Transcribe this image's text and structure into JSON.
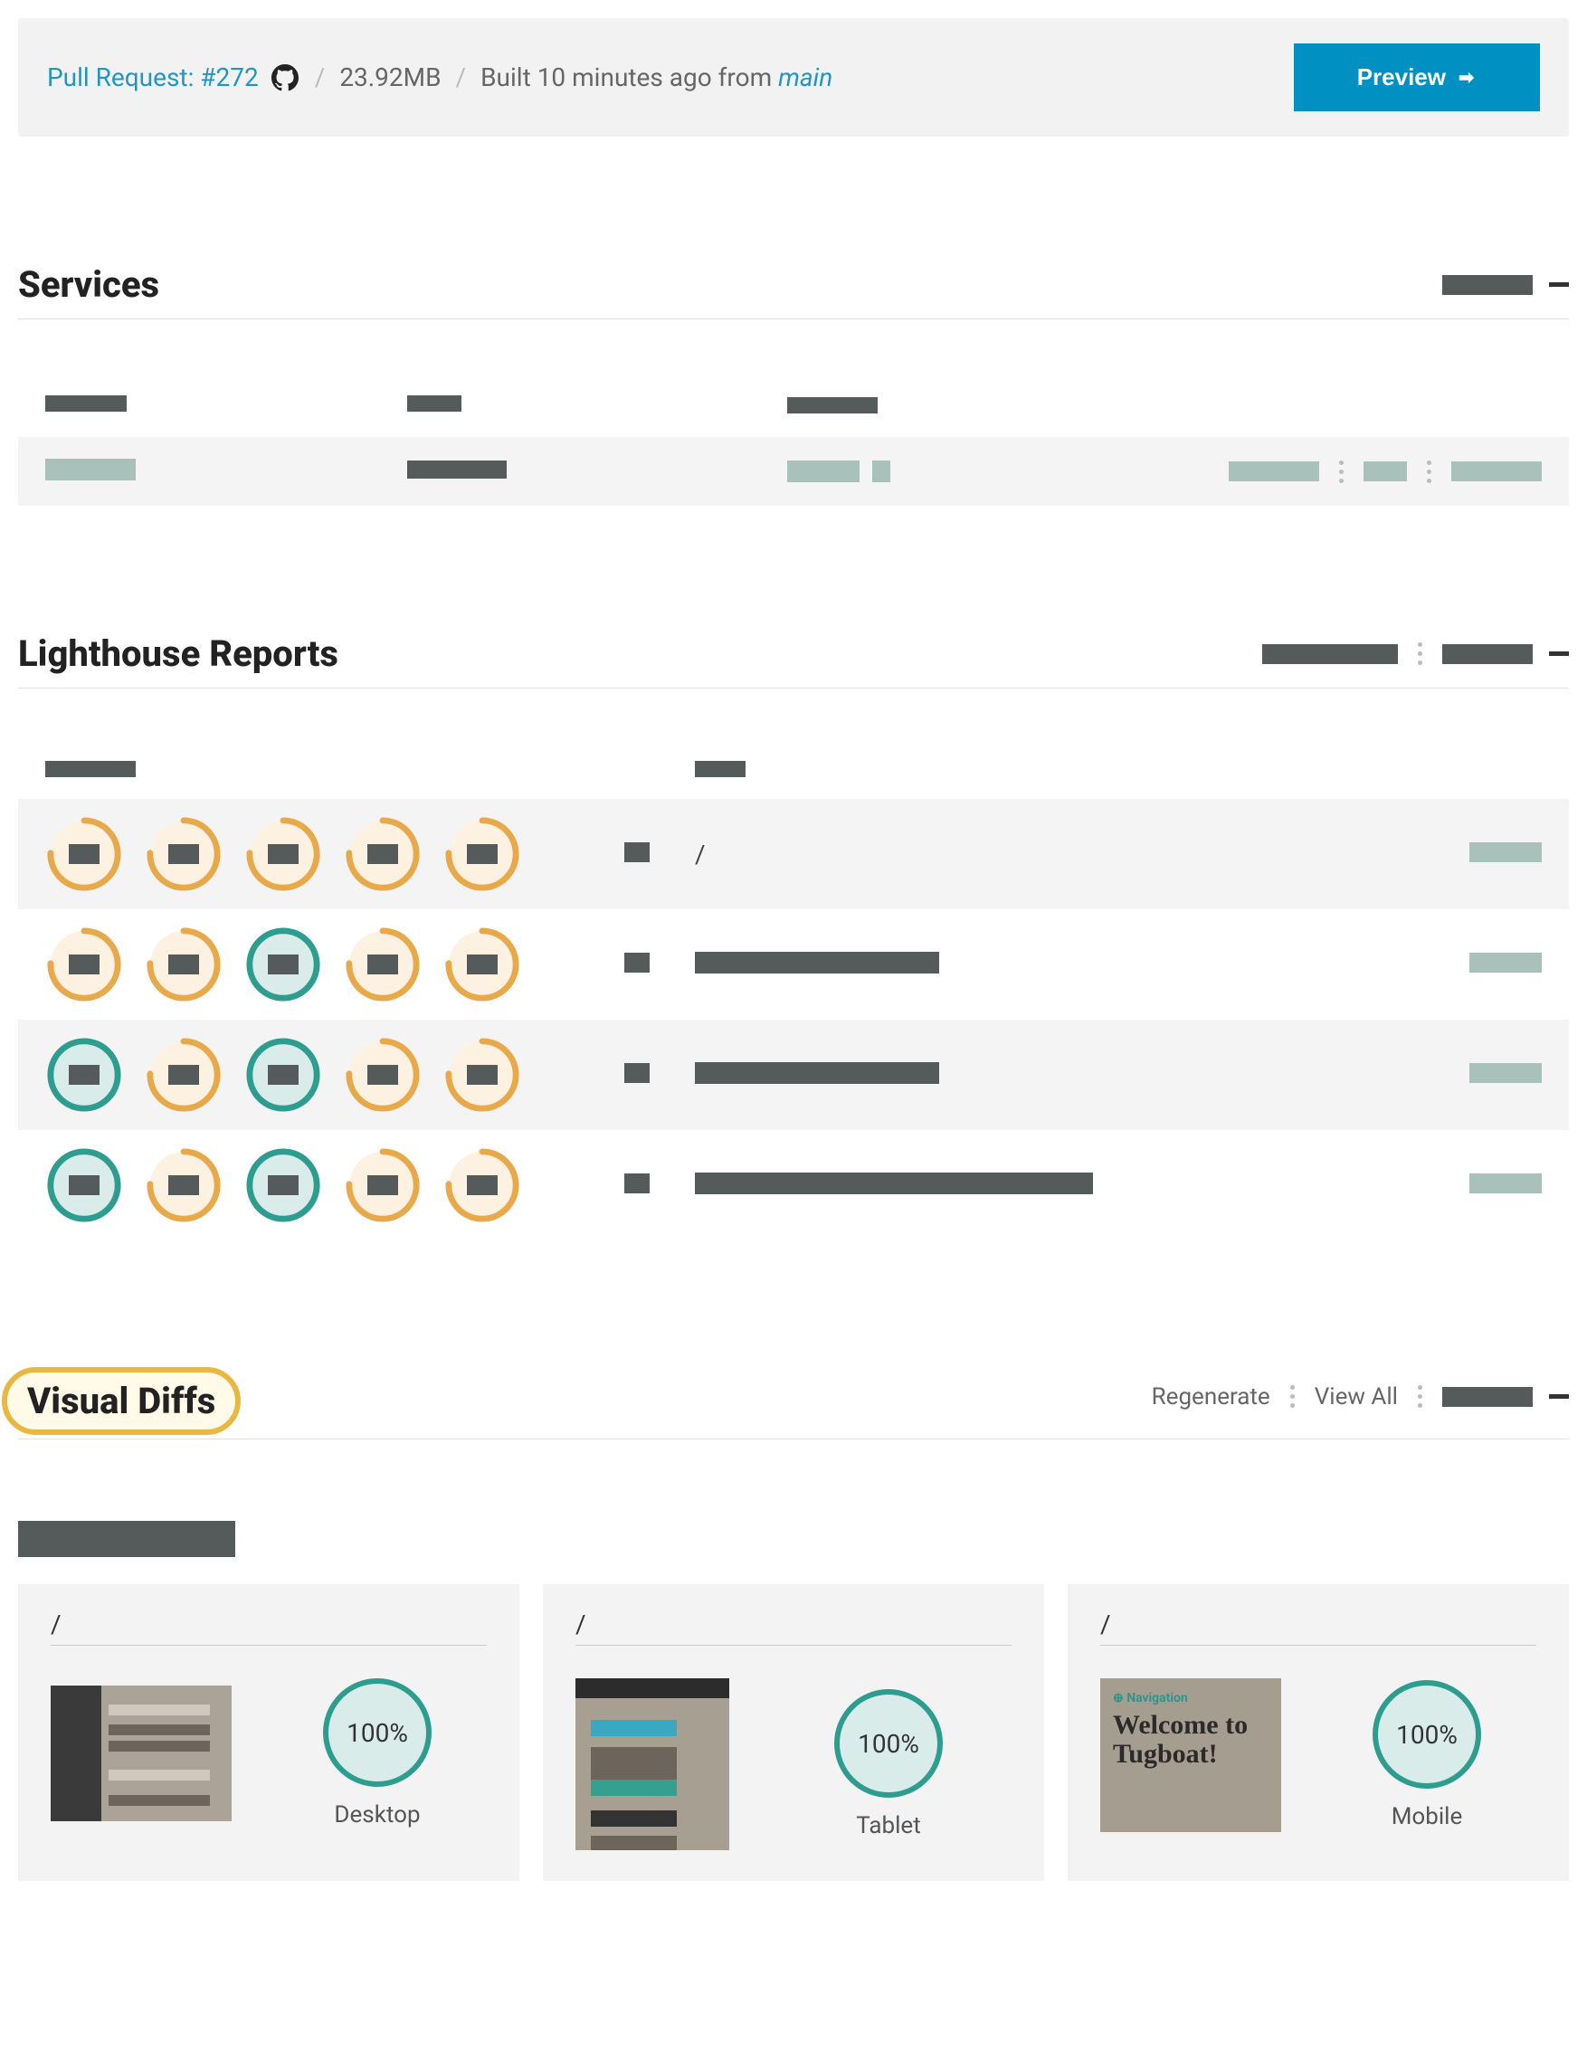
{
  "header": {
    "pr_label": "Pull Request: #272",
    "size": "23.92MB",
    "built_prefix": "Built 10 minutes ago from",
    "branch": "main",
    "preview_label": "Preview"
  },
  "services": {
    "title": "Services"
  },
  "lighthouse": {
    "title": "Lighthouse Reports",
    "rows": [
      {
        "path": "/",
        "scores": [
          "orange",
          "orange",
          "orange",
          "orange",
          "orange"
        ]
      },
      {
        "path": "",
        "scores": [
          "orange",
          "orange",
          "teal",
          "orange",
          "orange"
        ]
      },
      {
        "path": "",
        "scores": [
          "teal",
          "orange",
          "teal",
          "orange",
          "orange"
        ]
      },
      {
        "path": "",
        "scores": [
          "teal",
          "orange",
          "teal",
          "orange",
          "orange"
        ]
      }
    ]
  },
  "visual_diffs": {
    "title": "Visual Diffs",
    "regenerate_label": "Regenerate",
    "view_all_label": "View All",
    "cards": [
      {
        "path": "/",
        "pct": "100%",
        "device": "Desktop"
      },
      {
        "path": "/",
        "pct": "100%",
        "device": "Tablet"
      },
      {
        "path": "/",
        "pct": "100%",
        "device": "Mobile"
      }
    ],
    "mobile_thumb": {
      "nav": "⊕ Navigation",
      "headline": "Welcome to Tugboat!"
    }
  }
}
